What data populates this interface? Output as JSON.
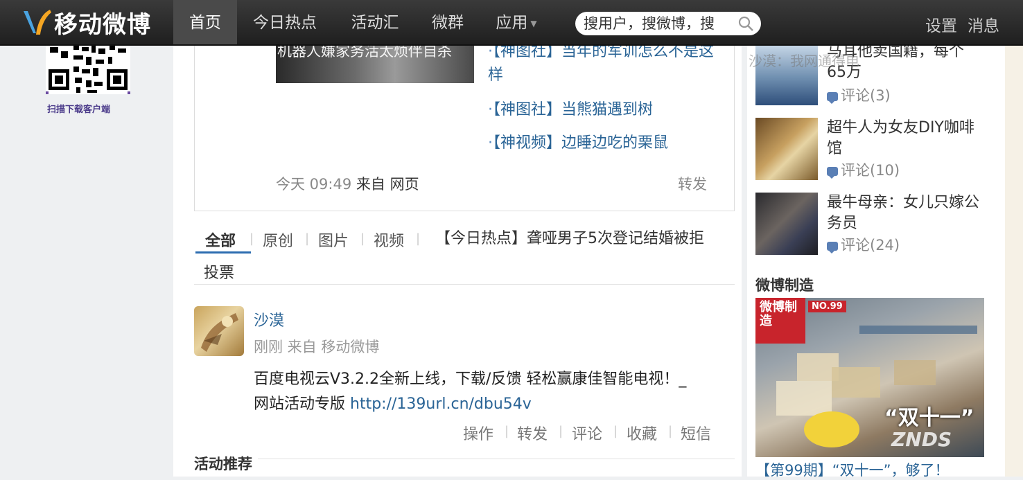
{
  "header": {
    "logo_text": "移动微博",
    "nav": [
      "首页",
      "今日热点",
      "活动汇",
      "微群",
      "应用"
    ],
    "search_placeholder": "搜用户，搜微博，搜",
    "settings": "设置",
    "messages": "消息"
  },
  "sidebar": {
    "qr_caption": "扫描下载客户端"
  },
  "feature": {
    "image_caption": "机器人嫌家务活太烦伴自杀",
    "links": [
      "【神图社】当年的军训怎么不是这样",
      "【神图社】当熊猫遇到树",
      "【神视频】边睡边吃的栗鼠"
    ],
    "time": "今天 09:49",
    "source": "来自 网页",
    "forward": "转发"
  },
  "filters": {
    "tabs": [
      "全部",
      "原创",
      "图片",
      "视频"
    ],
    "hot_news": "【今日热点】聋哑男子5次登记结婚被拒",
    "vote": "投票"
  },
  "post": {
    "user": "沙漠",
    "time_source": "刚刚 来自 移动微博",
    "text": "百度电视云V3.2.2全新上线，下载/反馈 轻松赢康佳智能电视！_网站活动专版 ",
    "link": "http://139url.cn/dbu54v",
    "actions": [
      "操作",
      "转发",
      "评论",
      "收藏",
      "短信"
    ]
  },
  "activity_title": "活动推荐",
  "right": {
    "items": [
      {
        "title": "马耳他卖国籍，每个65万",
        "comments": "评论(3)"
      },
      {
        "title": "超牛人为女友DIY咖啡馆",
        "comments": "评论(10)"
      },
      {
        "title": "最牛母亲：女儿只嫁公务员",
        "comments": "评论(24)"
      }
    ],
    "overlay_text": "沙漠：我网通得电",
    "section_title": "微博制造",
    "badge_text": "微博制造",
    "badge_no": "NO.99",
    "slogan": "“双十一”",
    "watermark": "ZNDS",
    "big_caption": "【第99期】“双十一”，够了！"
  }
}
